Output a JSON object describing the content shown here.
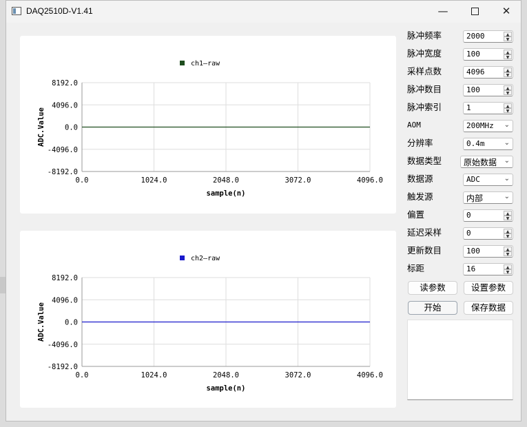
{
  "window": {
    "title": "DAQ2510D-V1.41"
  },
  "titlebar_controls": {
    "minimize": "—",
    "maximize": "",
    "close": "✕"
  },
  "params": [
    {
      "label": "脉冲频率",
      "type": "spin",
      "value": "2000"
    },
    {
      "label": "脉冲宽度",
      "type": "spin",
      "value": "100"
    },
    {
      "label": "采样点数",
      "type": "spin",
      "value": "4096"
    },
    {
      "label": "脉冲数目",
      "type": "spin",
      "value": "100"
    },
    {
      "label": "脉冲索引",
      "type": "spin",
      "value": "1"
    },
    {
      "label": "AOM",
      "type": "combo",
      "value": "200MHz"
    },
    {
      "label": "分辨率",
      "type": "combo",
      "value": "0.4m"
    },
    {
      "label": "数据类型",
      "type": "combo",
      "value": "原始数据"
    },
    {
      "label": "数据源",
      "type": "combo",
      "value": "ADC"
    },
    {
      "label": "触发源",
      "type": "combo",
      "value": "内部"
    },
    {
      "label": "偏置",
      "type": "spin",
      "value": "0"
    },
    {
      "label": "延迟采样",
      "type": "spin",
      "value": "0"
    },
    {
      "label": "更新数目",
      "type": "spin",
      "value": "100"
    },
    {
      "label": "标距",
      "type": "spin",
      "value": "16"
    }
  ],
  "buttons": {
    "read_params": "读参数",
    "set_params": "设置参数",
    "start": "开始",
    "save_data": "保存数据"
  },
  "log_text": "",
  "chart_data": [
    {
      "type": "line",
      "xlabel": "sample(n)",
      "ylabel": "ADC.Value",
      "xlim": [
        0,
        4096
      ],
      "ylim": [
        -8192,
        8192
      ],
      "x_ticks": [
        "0.0",
        "1024.0",
        "2048.0",
        "3072.0",
        "4096.0"
      ],
      "y_ticks": [
        "8192.0",
        "4096.0",
        "0.0",
        "-4096.0",
        "-8192.0"
      ],
      "grid": true,
      "legend_position": "top-center",
      "series": [
        {
          "name": "ch1—raw",
          "color": "#1e4d1e",
          "x": [
            0,
            4096
          ],
          "y": [
            0,
            0
          ]
        }
      ]
    },
    {
      "type": "line",
      "xlabel": "sample(n)",
      "ylabel": "ADC.Value",
      "xlim": [
        0,
        4096
      ],
      "ylim": [
        -8192,
        8192
      ],
      "x_ticks": [
        "0.0",
        "1024.0",
        "2048.0",
        "3072.0",
        "4096.0"
      ],
      "y_ticks": [
        "8192.0",
        "4096.0",
        "0.0",
        "-4096.0",
        "-8192.0"
      ],
      "grid": true,
      "legend_position": "top-center",
      "series": [
        {
          "name": "ch2—raw",
          "color": "#1a1acc",
          "x": [
            0,
            4096
          ],
          "y": [
            0,
            0
          ]
        }
      ]
    }
  ]
}
